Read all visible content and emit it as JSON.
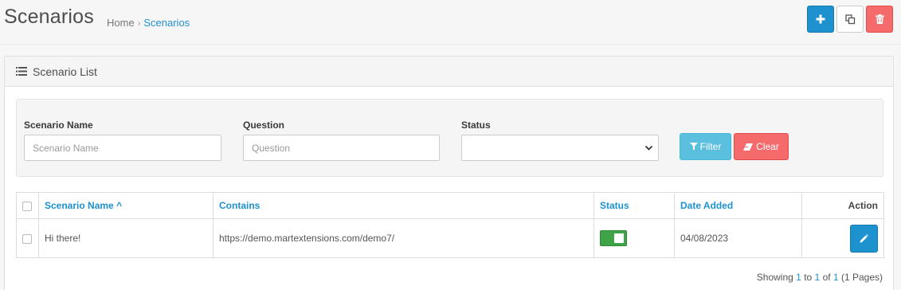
{
  "header": {
    "title": "Scenarios",
    "breadcrumb": [
      {
        "label": "Home"
      },
      {
        "label": "Scenarios"
      }
    ],
    "breadcrumb_separator": "›",
    "actions": [
      {
        "name": "add",
        "icon": "plus-icon",
        "color": "#1e91cf"
      },
      {
        "name": "copy",
        "icon": "copy-icon",
        "color": "#ffffff"
      },
      {
        "name": "delete",
        "icon": "trash-icon",
        "color": "#f56b6b"
      }
    ]
  },
  "panel": {
    "title": "Scenario List",
    "icon": "list-icon"
  },
  "filters": {
    "scenario_name": {
      "label": "Scenario Name",
      "placeholder": "Scenario Name",
      "value": ""
    },
    "question": {
      "label": "Question",
      "placeholder": "Question",
      "value": ""
    },
    "status": {
      "label": "Status",
      "value": ""
    },
    "filter_label": "Filter",
    "clear_label": "Clear"
  },
  "table": {
    "columns": {
      "name": "Scenario Name",
      "contains": "Contains",
      "status": "Status",
      "date_added": "Date Added",
      "action": "Action"
    },
    "sort_indicator": "^",
    "rows": [
      {
        "name": "Hi there!",
        "contains": "https://demo.martextensions.com/demo7/",
        "status_enabled": true,
        "date_added": "04/08/2023"
      }
    ]
  },
  "pagination": {
    "prefix": "Showing",
    "from": "1",
    "to_word": "to",
    "to": "1",
    "of_word": "of",
    "total": "1",
    "pages": "(1 Pages)"
  },
  "colors": {
    "primary": "#1e91cf",
    "danger": "#f56b6b",
    "info": "#5bc0de",
    "success": "#3ea447"
  }
}
